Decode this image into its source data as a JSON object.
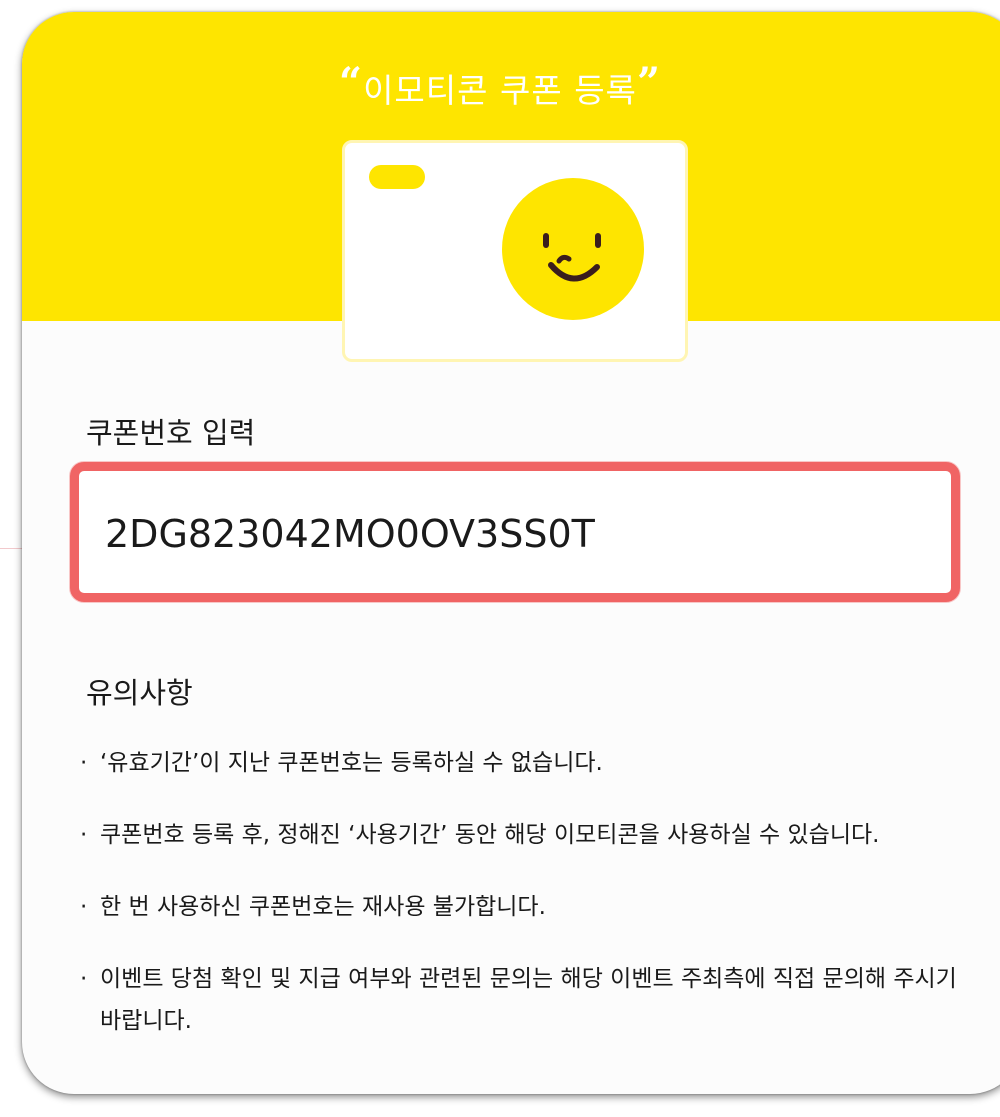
{
  "title": {
    "open_quote": "“",
    "text": "이모티콘 쿠폰 등록",
    "close_quote": "”"
  },
  "coupon": {
    "label": "쿠폰번호 입력",
    "value": "2DG823042MO0OV3SS0T"
  },
  "notice": {
    "title": "유의사항",
    "items": [
      "‘유효기간’이 지난 쿠폰번호는 등록하실 수 없습니다.",
      "쿠폰번호 등록 후, 정해진 ‘사용기간’ 동안 해당 이모티콘을 사용하실 수 있습니다.",
      "한 번 사용하신 쿠폰번호는 재사용 불가합니다.",
      "이벤트 당첨 확인 및 지급 여부와 관련된 문의는 해당 이벤트 주최측에 직접 문의해 주시기 바랍니다."
    ]
  },
  "colors": {
    "brand_yellow": "#fee500",
    "highlight_red": "#f06464"
  },
  "icons": {
    "ticket": "emoticon-ticket-icon",
    "face": "smiley-face-icon"
  }
}
